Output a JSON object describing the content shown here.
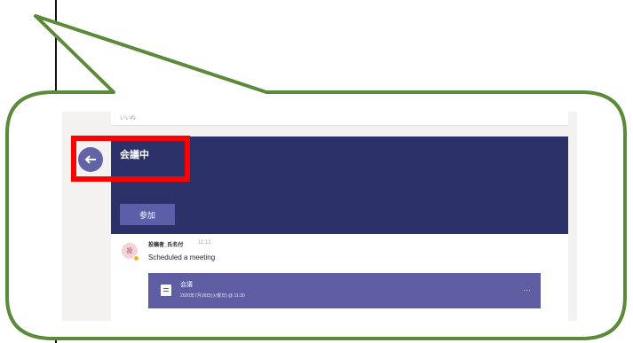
{
  "previous_card": {
    "text": "いいね"
  },
  "meeting_banner": {
    "title": "会議中",
    "join_label": "参加"
  },
  "message": {
    "sender": "投稿者_氏名付",
    "time": "11:12",
    "text": "Scheduled a meeting",
    "avatar_initial": "投"
  },
  "meeting_card": {
    "title": "会議",
    "date": "2020年7月28日(火曜日) @ 11:30"
  },
  "colors": {
    "callout_border": "#5a8a3a",
    "highlight_border": "#ff0000",
    "banner_bg": "#2b3169",
    "meeting_card_bg": "#5f5ea3",
    "avatar_meet_bg": "#6264a7"
  },
  "icons": {
    "meeting": "arrow-left-icon",
    "calendar": "calendar-icon",
    "more": "more-options-icon",
    "status": "status-away-dot"
  }
}
